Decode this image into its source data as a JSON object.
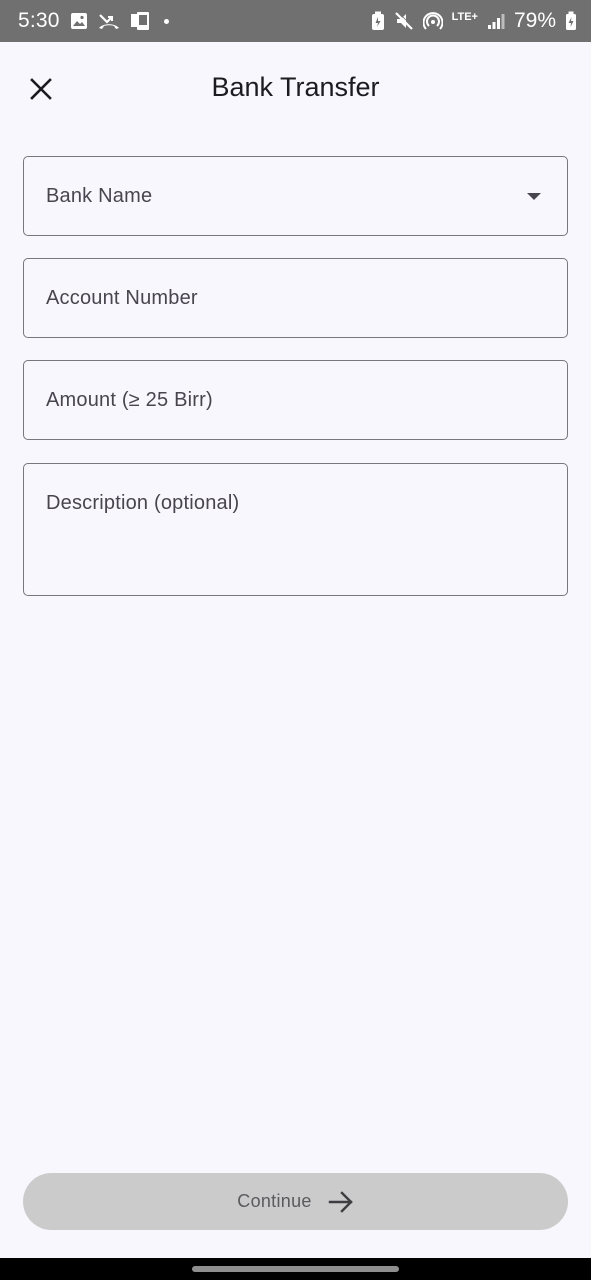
{
  "status_bar": {
    "time": "5:30",
    "lte": "LTE+",
    "battery": "79%",
    "left_icons": [
      "image-icon",
      "missed-call-icon",
      "device-icon",
      "notification-dot-icon"
    ],
    "right_icons": [
      "battery-saver-icon",
      "mute-icon",
      "hotspot-icon",
      "signal-icon",
      "battery-icon"
    ]
  },
  "header": {
    "title": "Bank Transfer",
    "close_icon": "close-icon"
  },
  "form": {
    "bank_name": {
      "label": "Bank Name",
      "icon": "dropdown-arrow-icon"
    },
    "account_number": {
      "label": "Account Number"
    },
    "amount": {
      "label": "Amount (≥ 25 Birr)"
    },
    "description": {
      "label": "Description (optional)"
    }
  },
  "continue_button": {
    "label": "Continue",
    "icon": "arrow-right-icon",
    "enabled": false
  },
  "colors": {
    "background": "#f8f7fd",
    "status_bar": "#707070",
    "field_border": "#79767d",
    "button_disabled": "#cbcbcb"
  }
}
